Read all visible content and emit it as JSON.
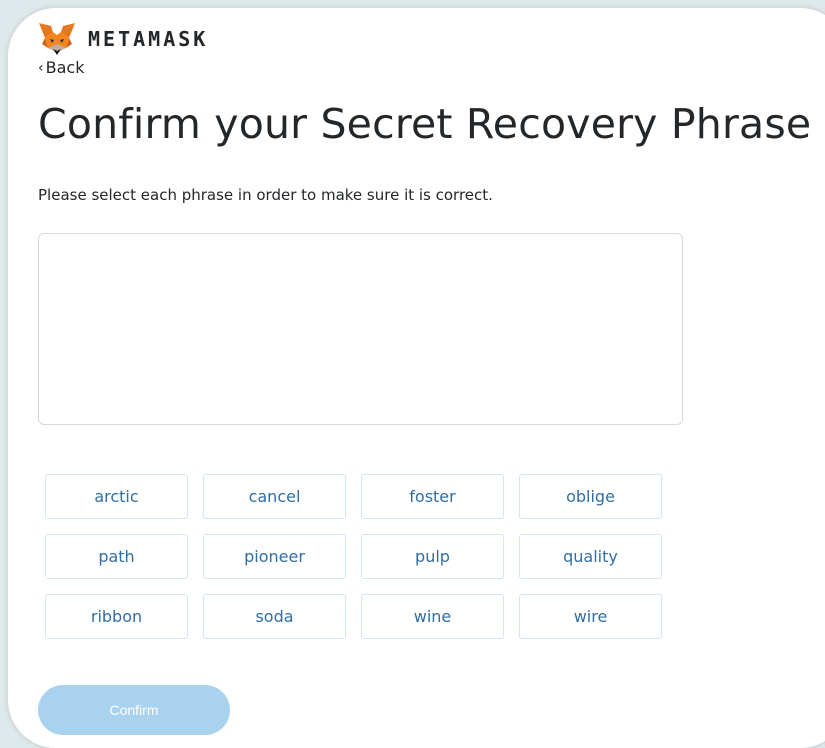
{
  "header": {
    "brand": "METAMASK",
    "back_label": "Back"
  },
  "page": {
    "title": "Confirm your Secret Recovery Phrase",
    "subtitle": "Please select each phrase in order to make sure it is correct."
  },
  "words": [
    "arctic",
    "cancel",
    "foster",
    "oblige",
    "path",
    "pioneer",
    "pulp",
    "quality",
    "ribbon",
    "soda",
    "wine",
    "wire"
  ],
  "confirm": {
    "label": "Confirm",
    "enabled": false
  },
  "colors": {
    "word_text": "#2f6ea5",
    "confirm_bg": "#a9d2ee",
    "fox_orange": "#e2761b"
  },
  "icons": {
    "logo": "metamask-fox-icon",
    "back": "chevron-left-icon"
  }
}
